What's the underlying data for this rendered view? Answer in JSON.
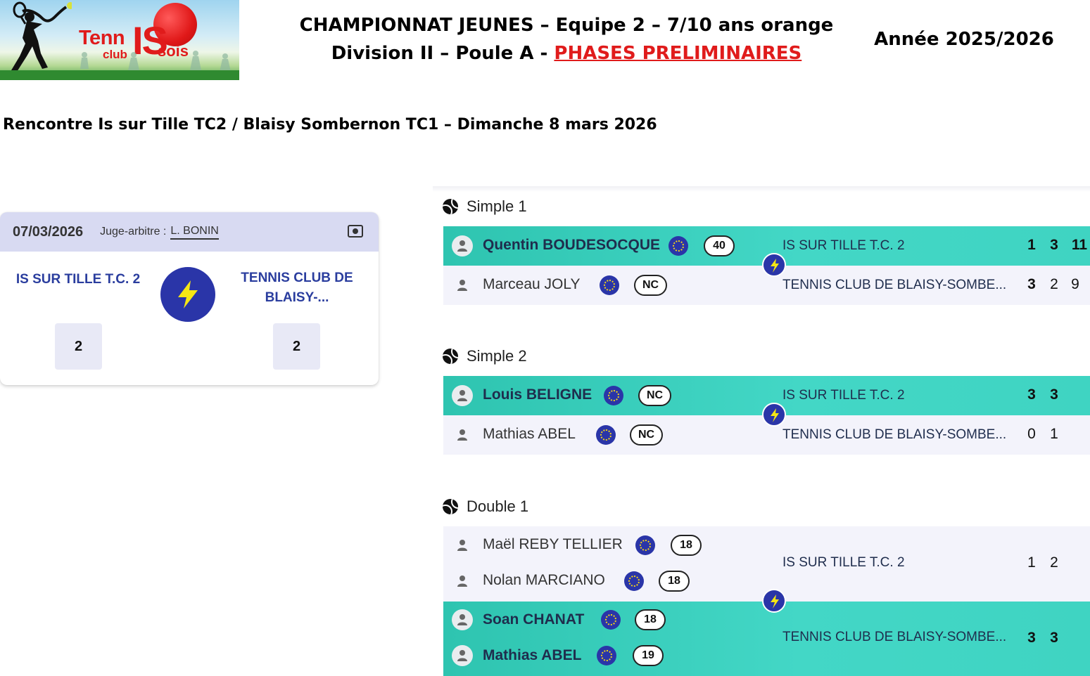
{
  "header": {
    "logo": {
      "text_tenn": "Tenn",
      "text_club": "club",
      "text_is": "IS",
      "text_sois": "sois"
    },
    "title_line1": "CHAMPIONNAT JEUNES – Equipe 2 – 7/10 ans orange",
    "title_line2_prefix": "Division II – Poule A - ",
    "title_line2_highlight": "PHASES PRELIMINAIRES",
    "year": "Année 2025/2026"
  },
  "rencontre": "Rencontre Is sur Tille TC2 / Blaisy Sombernon TC1 – Dimanche 8 mars 2026",
  "summary": {
    "date": "07/03/2026",
    "judge_label": "Juge-arbitre :",
    "judge_name": "L. BONIN",
    "home_team": "IS SUR TILLE T.C. 2",
    "away_team": "TENNIS CLUB DE BLAISY-...",
    "home_score": "2",
    "away_score": "2",
    "icon_color": "#2a35a8"
  },
  "matches": [
    {
      "title": "Simple 1",
      "team1": {
        "players": [
          {
            "name": "Quentin BOUDESOCQUE",
            "rank": "40"
          }
        ],
        "club": "IS SUR TILLE T.C. 2",
        "scores": [
          "1",
          "3",
          "11"
        ],
        "winner": true
      },
      "team2": {
        "players": [
          {
            "name": "Marceau JOLY",
            "rank": "NC"
          }
        ],
        "club": "TENNIS CLUB DE BLAISY-SOMBE...",
        "scores": [
          "3",
          "2",
          "9"
        ],
        "winner": false
      }
    },
    {
      "title": "Simple 2",
      "team1": {
        "players": [
          {
            "name": "Louis BELIGNE",
            "rank": "NC"
          }
        ],
        "club": "IS SUR TILLE T.C. 2",
        "scores": [
          "3",
          "3"
        ],
        "winner": true
      },
      "team2": {
        "players": [
          {
            "name": "Mathias ABEL",
            "rank": "NC"
          }
        ],
        "club": "TENNIS CLUB DE BLAISY-SOMBE...",
        "scores": [
          "0",
          "1"
        ],
        "winner": false
      }
    },
    {
      "title": "Double 1",
      "team1": {
        "players": [
          {
            "name": "Maël REBY TELLIER",
            "rank": "18"
          },
          {
            "name": "Nolan MARCIANO",
            "rank": "18"
          }
        ],
        "club": "IS SUR TILLE T.C. 2",
        "scores": [
          "1",
          "2"
        ],
        "winner": false
      },
      "team2": {
        "players": [
          {
            "name": "Soan CHANAT",
            "rank": "18"
          },
          {
            "name": "Mathias ABEL",
            "rank": "19"
          }
        ],
        "club": "TENNIS CLUB DE BLAISY-SOMBE...",
        "scores": [
          "3",
          "3"
        ],
        "winner": true
      }
    }
  ],
  "colors": {
    "winner_row": "#3fd4c2",
    "loser_row": "#f3f3fb",
    "accent_blue": "#2a35a8",
    "title_red": "#e01b1b",
    "team_blue": "#2a3d9e"
  }
}
